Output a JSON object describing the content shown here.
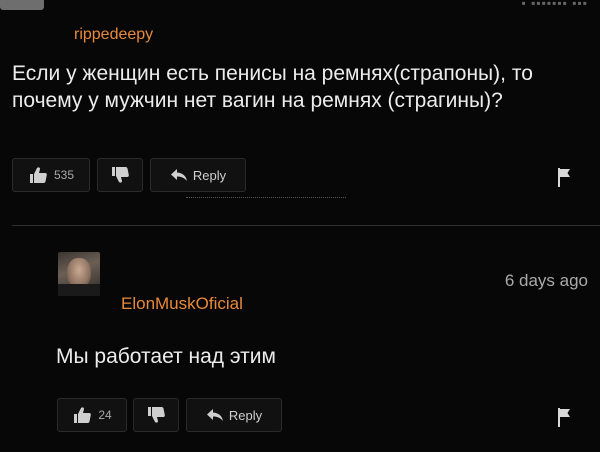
{
  "comment1": {
    "username": "rippedeepy",
    "text": "Если у женщин есть пенисы на ремнях(страпоны), то почему у мужчин нет вагин на ремнях (страгины)?",
    "likes": "535",
    "reply_label": "Reply"
  },
  "comment2": {
    "username": "ElonMuskOficial",
    "time": "6 days ago",
    "text": "Мы работает над этим",
    "likes": "24",
    "reply_label": "Reply"
  },
  "icons": {
    "like": "thumbs-up-icon",
    "dislike": "thumbs-down-icon",
    "reply": "reply-arrow-icon",
    "flag": "flag-icon"
  },
  "colors": {
    "background": "#070707",
    "username": "#e8893a",
    "text": "#ececec"
  }
}
